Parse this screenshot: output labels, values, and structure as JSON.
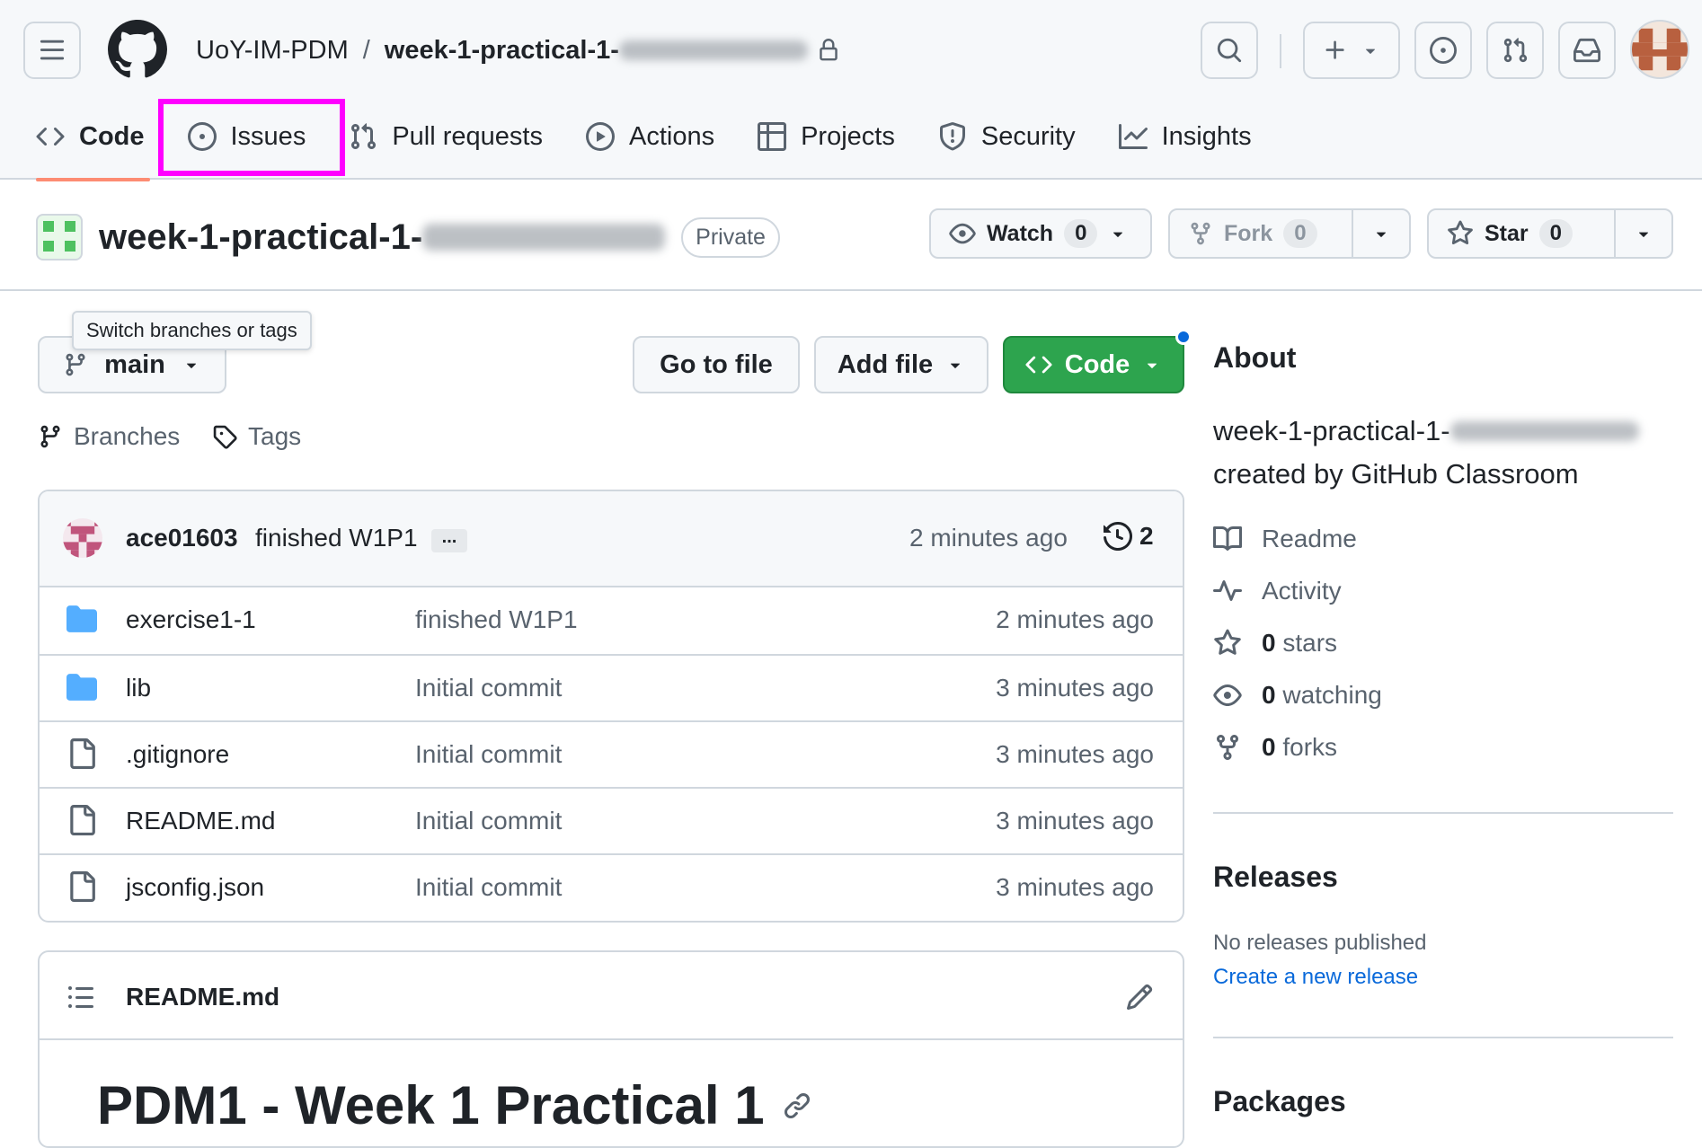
{
  "header": {
    "owner": "UoY-IM-PDM",
    "separator": "/",
    "repo_prefix": "week-1-practical-1-",
    "tabs": [
      {
        "label": "Code",
        "icon": "code-icon"
      },
      {
        "label": "Issues",
        "icon": "issue-opened-icon"
      },
      {
        "label": "Pull requests",
        "icon": "git-pull-request-icon"
      },
      {
        "label": "Actions",
        "icon": "play-icon"
      },
      {
        "label": "Projects",
        "icon": "table-icon"
      },
      {
        "label": "Security",
        "icon": "shield-icon"
      },
      {
        "label": "Insights",
        "icon": "graph-icon"
      }
    ],
    "selected_tab": "Code",
    "highlighted_tab": "Issues",
    "highlight_color": "#ff00ff"
  },
  "repo": {
    "name_prefix": "week-1-practical-1-",
    "visibility": "Private",
    "watch": {
      "label": "Watch",
      "count": "0"
    },
    "fork": {
      "label": "Fork",
      "count": "0"
    },
    "star": {
      "label": "Star",
      "count": "0"
    }
  },
  "toolbar": {
    "branch": "main",
    "tooltip": "Switch branches or tags",
    "go_to_file": "Go to file",
    "add_file": "Add file",
    "code": "Code",
    "branches_label": "Branches",
    "tags_label": "Tags"
  },
  "latest_commit": {
    "author": "ace01603",
    "message": "finished W1P1",
    "ellipsis": "...",
    "time": "2 minutes ago",
    "commit_count": "2"
  },
  "files": [
    {
      "name": "exercise1-1",
      "type": "folder",
      "message": "finished W1P1",
      "time": "2 minutes ago"
    },
    {
      "name": "lib",
      "type": "folder",
      "message": "Initial commit",
      "time": "3 minutes ago"
    },
    {
      "name": ".gitignore",
      "type": "file",
      "message": "Initial commit",
      "time": "3 minutes ago"
    },
    {
      "name": "README.md",
      "type": "file",
      "message": "Initial commit",
      "time": "3 minutes ago"
    },
    {
      "name": "jsconfig.json",
      "type": "file",
      "message": "Initial commit",
      "time": "3 minutes ago"
    }
  ],
  "readme": {
    "filename": "README.md",
    "heading": "PDM1 - Week 1 Practical 1"
  },
  "about": {
    "title": "About",
    "description_prefix": "week-1-practical-1-",
    "description_suffix": "created by GitHub Classroom",
    "readme": "Readme",
    "activity": "Activity",
    "stars_count": "0",
    "stars_label": "stars",
    "watching_count": "0",
    "watching_label": "watching",
    "forks_count": "0",
    "forks_label": "forks"
  },
  "releases": {
    "title": "Releases",
    "empty": "No releases published",
    "create_link": "Create a new release"
  },
  "packages": {
    "title": "Packages"
  },
  "colors": {
    "accent_green": "#2da44e",
    "link_blue": "#0969da",
    "folder_blue": "#54aeff",
    "tab_underline": "#fd8c73"
  }
}
